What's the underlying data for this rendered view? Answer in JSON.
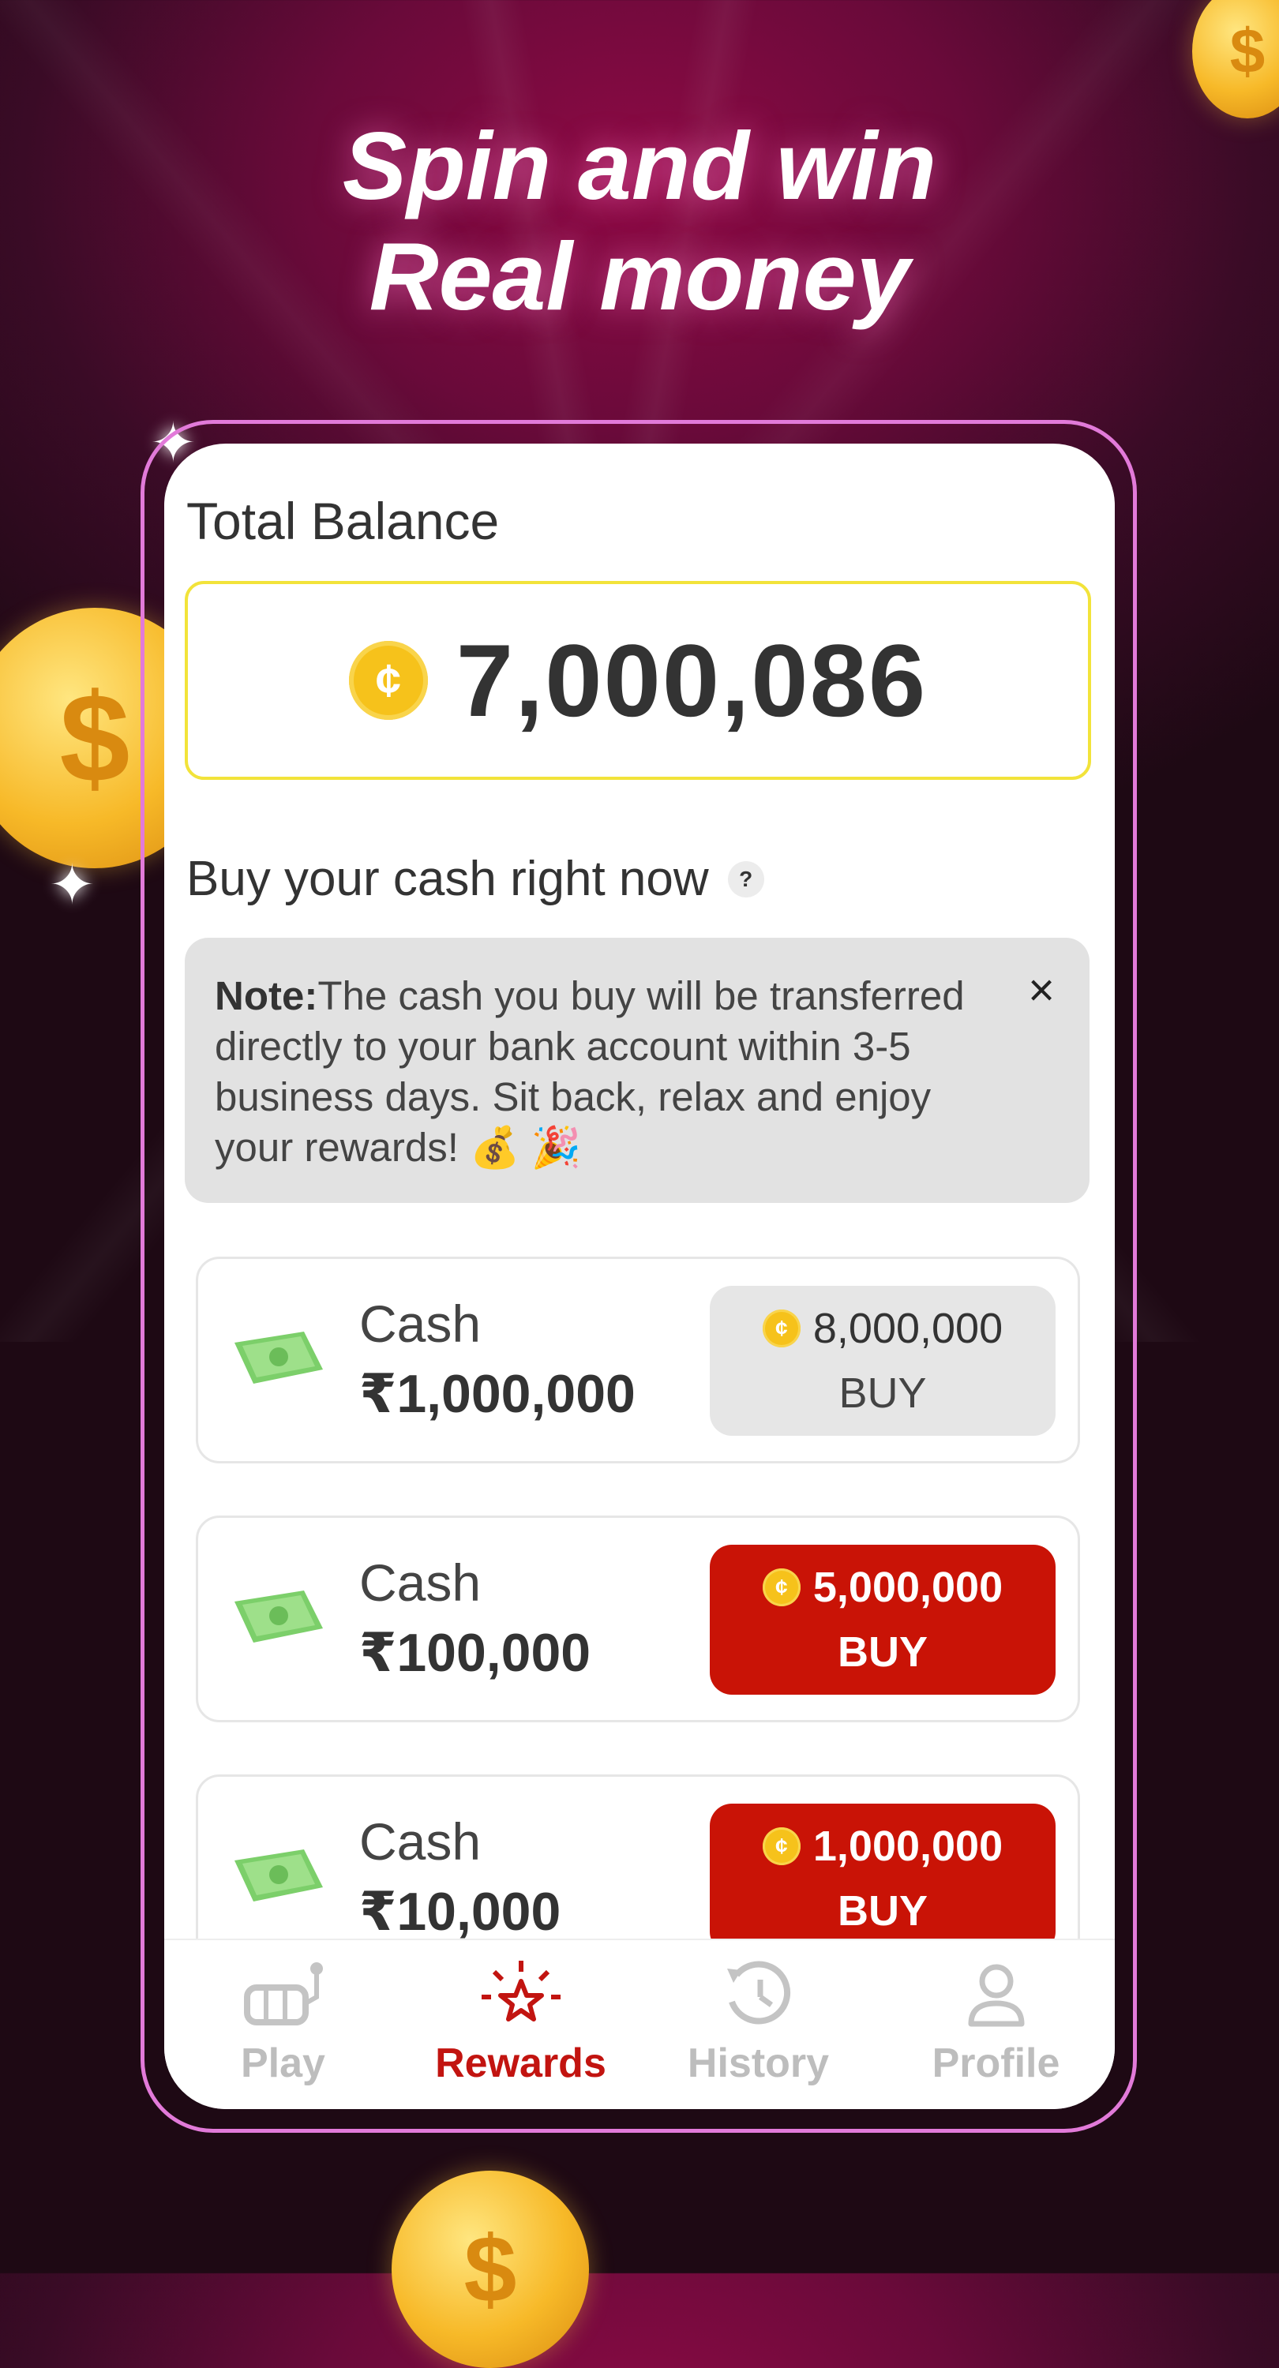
{
  "promo": {
    "headline_line1": "Spin and win",
    "headline_line2": "Real money"
  },
  "balance": {
    "label": "Total Balance",
    "coin_icon": "coin-icon",
    "value": "7,000,086"
  },
  "buy_section": {
    "title": "Buy your cash right now",
    "help_icon": "?",
    "note_bold": "Note:",
    "note_text": "The cash you buy will be transferred directly to your bank account within 3-5 business days. Sit back, relax and enjoy your rewards! 💰 🎉",
    "close_icon": "×"
  },
  "cash_items": [
    {
      "label": "Cash",
      "amount": "₹1,000,000",
      "price": "8,000,000",
      "button": "BUY",
      "state": "disabled"
    },
    {
      "label": "Cash",
      "amount": "₹100,000",
      "price": "5,000,000",
      "button": "BUY",
      "state": "active"
    },
    {
      "label": "Cash",
      "amount": "₹10,000",
      "price": "1,000,000",
      "button": "BUY",
      "state": "active"
    }
  ],
  "tabs": [
    {
      "label": "Play",
      "icon": "slot-machine-icon",
      "active": false
    },
    {
      "label": "Rewards",
      "icon": "star-burst-icon",
      "active": true
    },
    {
      "label": "History",
      "icon": "history-clock-icon",
      "active": false
    },
    {
      "label": "Profile",
      "icon": "user-icon",
      "active": false
    }
  ],
  "colors": {
    "accent_red": "#c91306",
    "active_tab": "#c21410",
    "frame_pink": "#e27ad9",
    "coin_gold": "#f6c21b"
  }
}
